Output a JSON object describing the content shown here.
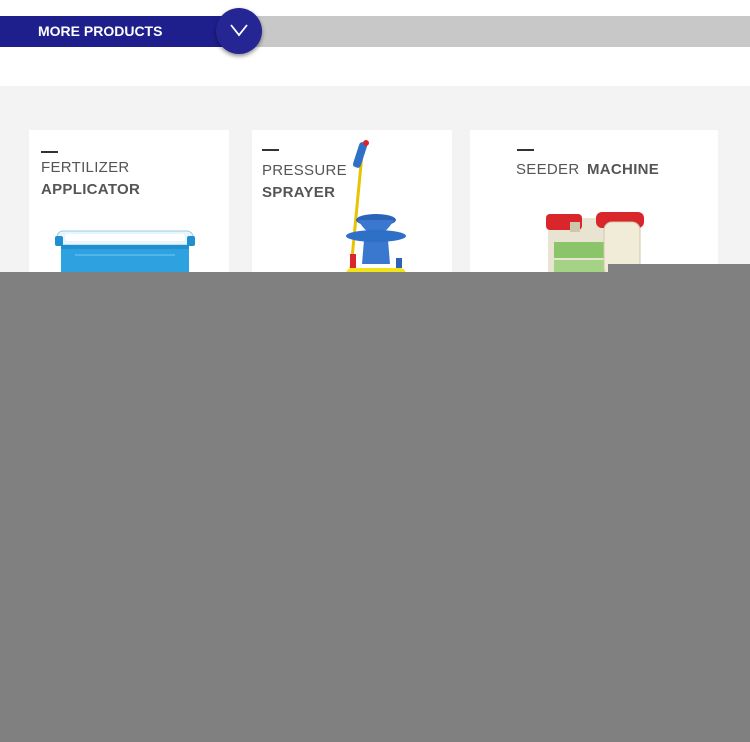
{
  "banner": {
    "label": "MORE PRODUCTS",
    "icon": "chevron-down-icon",
    "tab_color": "#1e1f8c",
    "bar_color": "#c8c8c8"
  },
  "products": [
    {
      "line1": "FERTILIZER",
      "line2": "APPLICATOR",
      "image": "fertilizer-applicator-image"
    },
    {
      "line1": "PRESSURE",
      "line2": "SPRAYER",
      "image": "pressure-sprayer-image"
    },
    {
      "line1": "SEEDER",
      "line2": "MACHINE",
      "image": "seeder-machine-image"
    }
  ],
  "overlay_color": "#808080"
}
